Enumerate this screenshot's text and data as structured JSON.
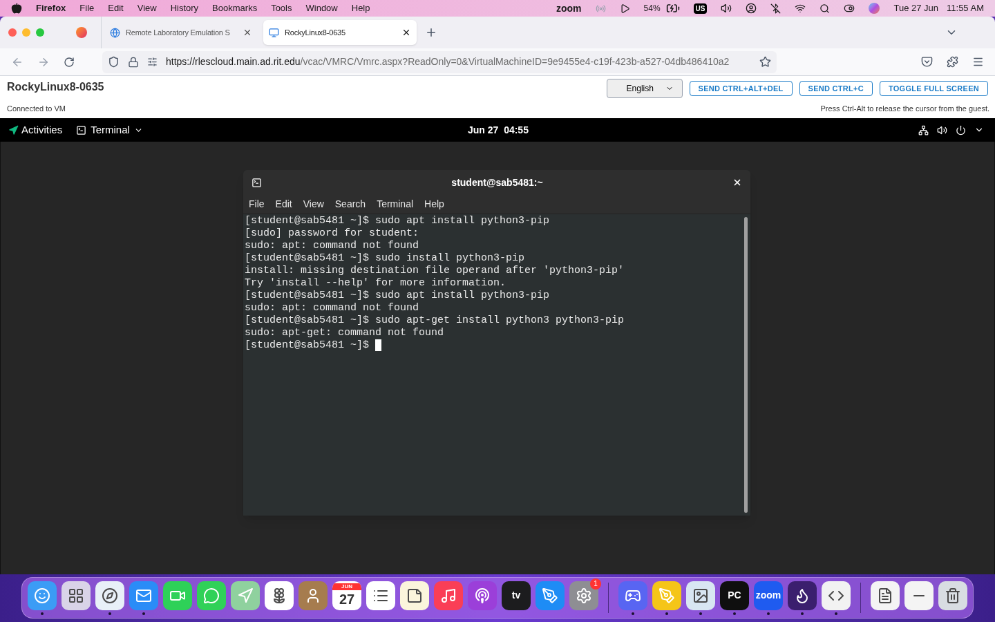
{
  "menu_bar": {
    "app": "Firefox",
    "items": [
      "File",
      "Edit",
      "View",
      "History",
      "Bookmarks",
      "Tools",
      "Window",
      "Help"
    ],
    "status": {
      "zoom": "zoom",
      "battery": "54%",
      "input": "US",
      "date": "Tue 27 Jun",
      "time": "11:55 AM"
    }
  },
  "tabs": [
    {
      "title": "Remote Laboratory Emulation S",
      "selected": false,
      "kind": "globe"
    },
    {
      "title": "RockyLinux8-0635",
      "selected": true,
      "kind": "monitor"
    }
  ],
  "address": {
    "domain": "https://rlescloud.main.ad.rit.edu",
    "path": "/vcac/VMRC/Vmrc.aspx?ReadOnly=0&VirtualMachineID=9e9455e4-c19f-423b-a527-04db486410a2"
  },
  "console": {
    "title": "RockyLinux8-0635",
    "status": "Connected to VM",
    "language": "English",
    "buttons": [
      "SEND CTRL+ALT+DEL",
      "SEND CTRL+C",
      "TOGGLE FULL SCREEN"
    ],
    "hint": "Press Ctrl-Alt to release the cursor from the guest."
  },
  "guest_bar": {
    "activities": "Activities",
    "app": "Terminal",
    "clock": "Jun 27  04:55"
  },
  "terminal": {
    "title": "student@sab5481:~",
    "menu": [
      "File",
      "Edit",
      "View",
      "Search",
      "Terminal",
      "Help"
    ],
    "lines": [
      "[student@sab5481 ~]$ sudo apt install python3-pip",
      "[sudo] password for student:",
      "sudo: apt: command not found",
      "[student@sab5481 ~]$ sudo install python3-pip",
      "install: missing destination file operand after 'python3-pip'",
      "Try 'install --help' for more information.",
      "[student@sab5481 ~]$ sudo apt install python3-pip",
      "sudo: apt: command not found",
      "[student@sab5481 ~]$ sudo apt-get install python3 python3-pip",
      "sudo: apt-get: command not found",
      "[student@sab5481 ~]$ "
    ]
  },
  "dock": [
    {
      "kind": "finder",
      "color": "#3b9cf5",
      "running": true
    },
    {
      "kind": "grid",
      "color": "#d9d3e8",
      "running": false
    },
    {
      "kind": "compass",
      "color": "#e8f0f8",
      "running": true
    },
    {
      "kind": "mail",
      "color": "#2a8cf7",
      "running": true
    },
    {
      "kind": "video",
      "color": "#2ed158",
      "running": false
    },
    {
      "kind": "chat",
      "color": "#30d158",
      "running": false
    },
    {
      "kind": "map",
      "color": "#8fd19e",
      "running": false
    },
    {
      "kind": "flower",
      "color": "#ffffff",
      "running": false
    },
    {
      "kind": "contact",
      "color": "#a67c4e",
      "running": false
    },
    {
      "kind": "calendar",
      "color": "#ffffff",
      "running": false,
      "top": "JUN",
      "label": "27"
    },
    {
      "kind": "list",
      "color": "#ffffff",
      "running": false
    },
    {
      "kind": "notes",
      "color": "#fbf5dc",
      "running": false
    },
    {
      "kind": "music",
      "color": "#fa3e56",
      "running": false
    },
    {
      "kind": "podcast",
      "color": "#9b3fd9",
      "running": false
    },
    {
      "kind": "text",
      "color": "#1c1c1e",
      "running": false,
      "label": "tv"
    },
    {
      "kind": "appstore",
      "color": "#1e8cf5",
      "running": false
    },
    {
      "kind": "gear",
      "color": "#8e8e93",
      "running": false,
      "badge": "1"
    },
    {
      "kind": "separator"
    },
    {
      "kind": "gamepad",
      "color": "#5865f2",
      "running": true
    },
    {
      "kind": "pen",
      "color": "#f5c518",
      "running": true
    },
    {
      "kind": "image",
      "color": "#d8e6f2",
      "running": true
    },
    {
      "kind": "text",
      "color": "#0f0f0f",
      "running": true,
      "label": "PC"
    },
    {
      "kind": "text",
      "color": "#1f5bf0",
      "running": true,
      "label": "zoom"
    },
    {
      "kind": "flame",
      "color": "#3b1f6e",
      "running": true
    },
    {
      "kind": "code",
      "color": "#f2f2f2",
      "running": true
    },
    {
      "kind": "separator"
    },
    {
      "kind": "file",
      "color": "#f4f4f4",
      "running": false
    },
    {
      "kind": "minus",
      "color": "#f4f4f4",
      "running": false
    },
    {
      "kind": "trash",
      "color": "#d8dde2",
      "running": false
    }
  ]
}
